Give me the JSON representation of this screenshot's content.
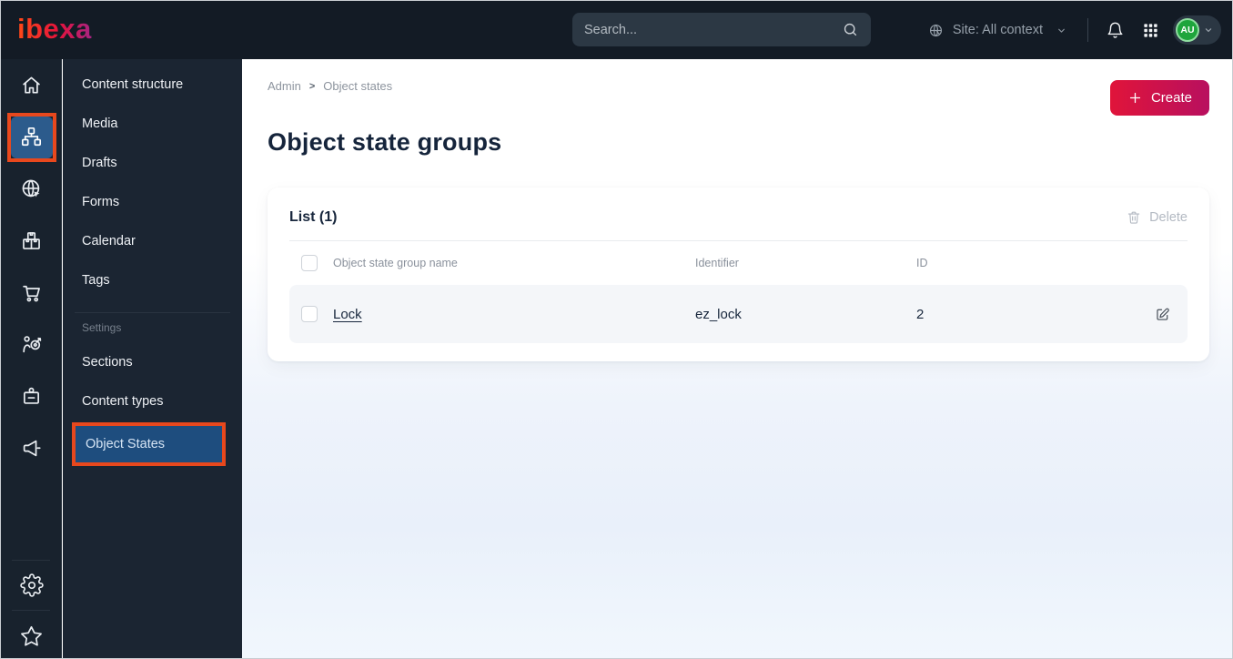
{
  "topbar": {
    "logo_text": "ibexa",
    "search_placeholder": "Search...",
    "site_label": "Site: All context",
    "avatar_initials": "AU",
    "icons": [
      "search-icon",
      "site-globe-icon",
      "chevron-down-icon",
      "notifications-bell-icon",
      "app-grid-icon"
    ]
  },
  "nav_rail": {
    "icons": [
      "home-icon",
      "content-structure-icon",
      "site-icon",
      "products-icon",
      "commerce-icon",
      "personalization-icon",
      "corporate-icon",
      "campaigns-icon",
      "settings-gear-icon",
      "bookmarks-star-icon"
    ],
    "active_icon": "content-structure-icon"
  },
  "menu": {
    "items": [
      "Content structure",
      "Media",
      "Drafts",
      "Forms",
      "Calendar",
      "Tags"
    ],
    "settings_label": "Settings",
    "settings_items": [
      "Sections",
      "Content types",
      "Object States"
    ],
    "active_item": "Object States"
  },
  "content": {
    "breadcrumb": {
      "root": "Admin",
      "separator": ">",
      "current": "Object states"
    },
    "create_button": "Create",
    "page_title": "Object state groups",
    "list_card": {
      "title": "List (1)",
      "delete_button": "Delete",
      "columns": {
        "name": "Object state group name",
        "identifier": "Identifier",
        "id": "ID"
      },
      "rows": [
        {
          "name": "Lock",
          "identifier": "ez_lock",
          "id": "2"
        }
      ]
    }
  },
  "colors": {
    "topbar_bg": "#131b25",
    "annotation_orange": "#e8481d",
    "active_menu_blue": "#1e4d7e",
    "rail_active_tile_blue": "#2c5b8c",
    "create_gradient_start": "#e0143a",
    "create_gradient_end": "#b8105f",
    "avatar_green": "#1ea53c",
    "page_tint_blue": "#e9f0fa"
  }
}
